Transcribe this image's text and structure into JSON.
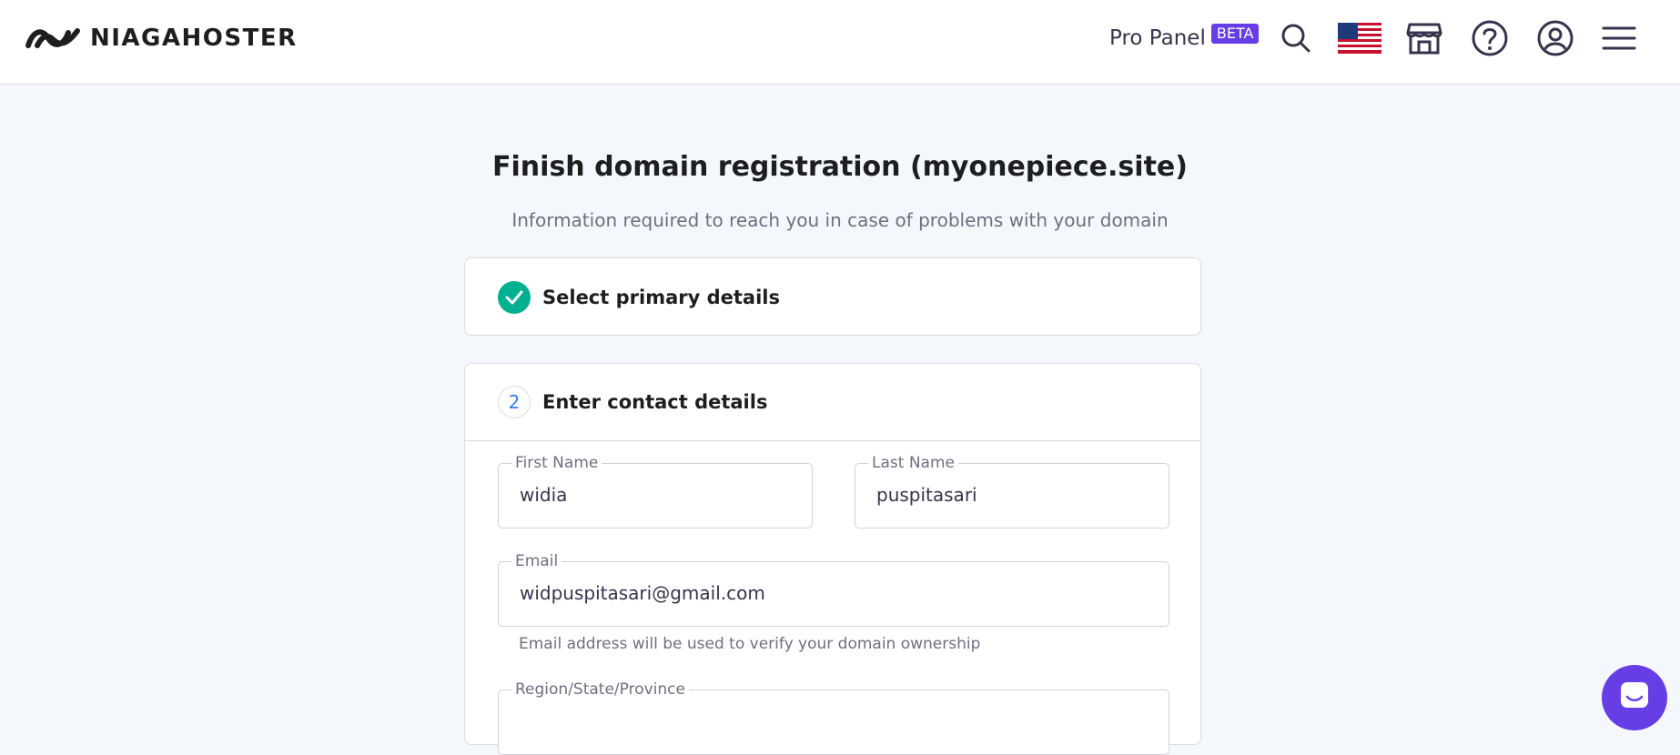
{
  "header": {
    "brand": "NIAGAHOSTER",
    "pro_panel_label": "Pro Panel",
    "beta_badge": "BETA",
    "icons": [
      "search-icon",
      "us-flag-icon",
      "store-icon",
      "help-icon",
      "account-icon",
      "menu-icon"
    ]
  },
  "page": {
    "title": "Finish domain registration (myonepiece.site)",
    "subtitle": "Information required to reach you in case of problems with your domain"
  },
  "steps": [
    {
      "status": "complete",
      "title": "Select primary details"
    },
    {
      "number": "2",
      "title": "Enter contact details"
    }
  ],
  "form": {
    "first_name": {
      "label": "First Name",
      "value": "widia"
    },
    "last_name": {
      "label": "Last Name",
      "value": "puspitasari"
    },
    "email": {
      "label": "Email",
      "value": "widpuspitasari@gmail.com",
      "hint": "Email address will be used to verify your domain ownership"
    },
    "region": {
      "label": "Region/State/Province",
      "value": ""
    }
  },
  "colors": {
    "brand_purple": "#673de6",
    "success_green": "#00b090",
    "step_blue": "#357df9",
    "background": "#f4f7fb"
  }
}
